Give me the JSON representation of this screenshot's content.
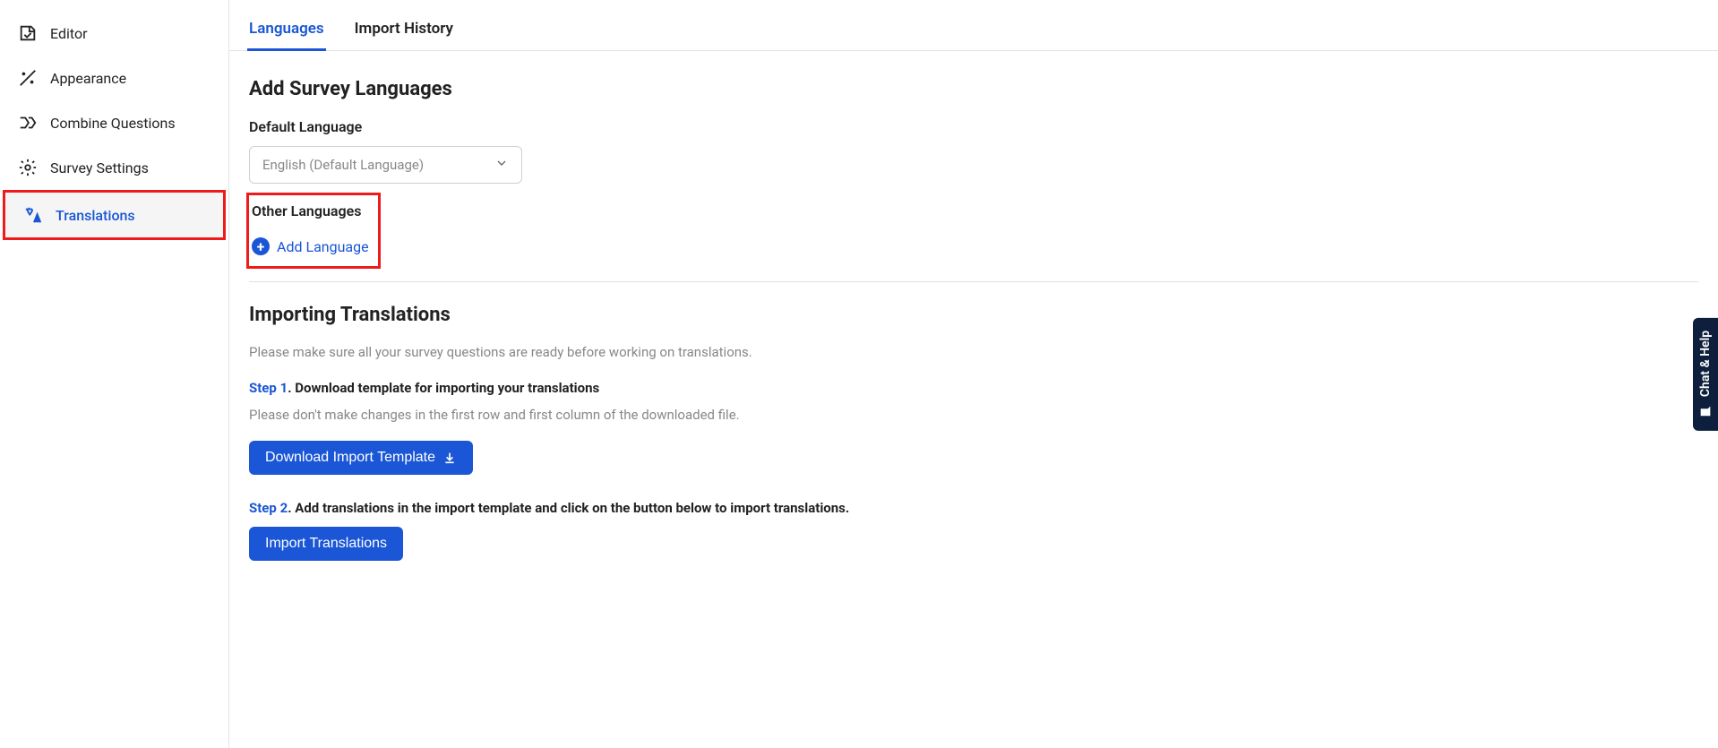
{
  "sidebar": {
    "items": [
      {
        "label": "Editor"
      },
      {
        "label": "Appearance"
      },
      {
        "label": "Combine Questions"
      },
      {
        "label": "Survey Settings"
      },
      {
        "label": "Translations"
      }
    ]
  },
  "tabs": [
    {
      "label": "Languages"
    },
    {
      "label": "Import History"
    }
  ],
  "addSurvey": {
    "title": "Add Survey Languages",
    "defaultLabel": "Default Language",
    "defaultValue": "English (Default Language)",
    "otherLabel": "Other Languages",
    "addLanguageLabel": "Add Language"
  },
  "importing": {
    "title": "Importing Translations",
    "intro": "Please make sure all your survey questions are ready before working on translations.",
    "step1Label": "Step 1",
    "step1Text": ". Download template for importing your translations",
    "step1Help": "Please don't make changes in the first row and first column of the downloaded file.",
    "downloadBtn": "Download Import Template",
    "step2Label": "Step 2",
    "step2Text": ". Add translations in the import template and click on the button below to import translations.",
    "importBtn": "Import Translations"
  },
  "chatHelp": "Chat & Help"
}
